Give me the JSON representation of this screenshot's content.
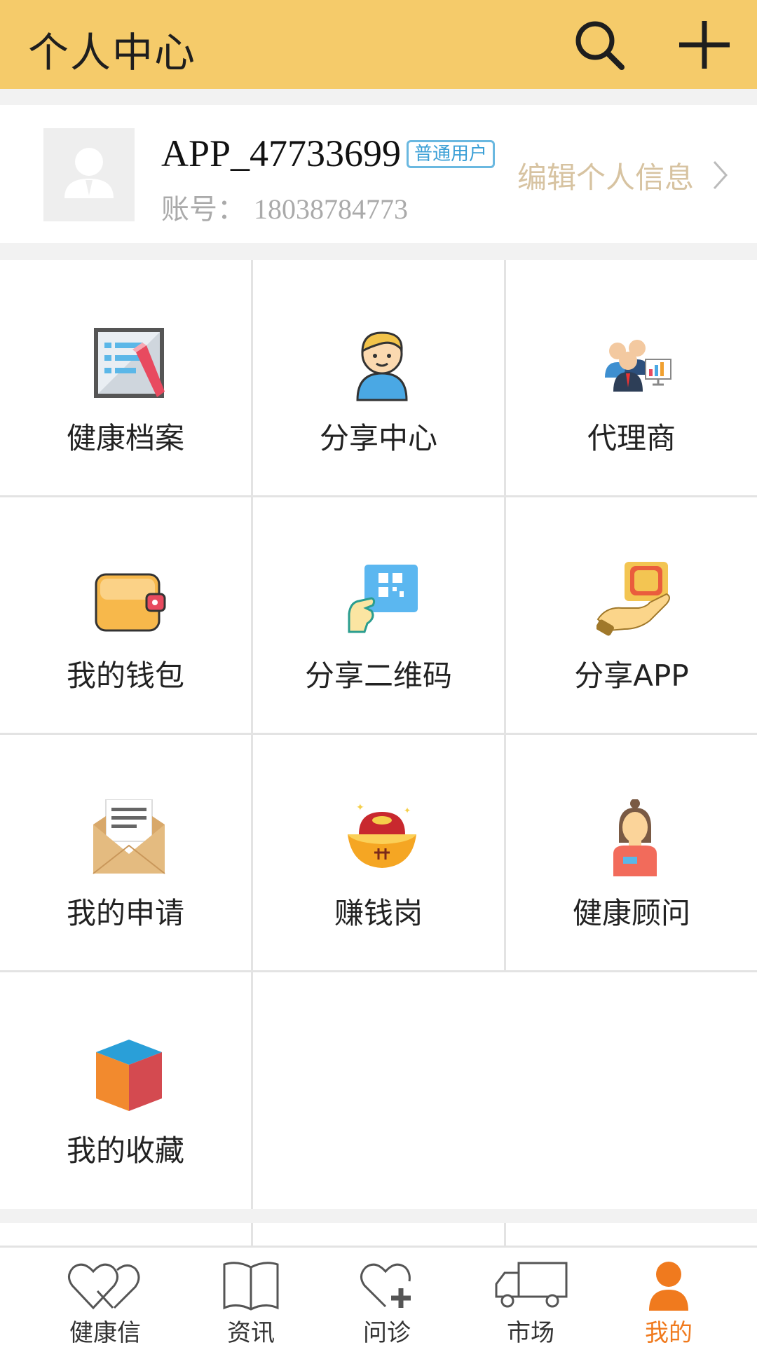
{
  "header": {
    "title": "个人中心",
    "search_icon": "search-icon",
    "add_icon": "plus-icon",
    "bg_color": "#f5cb6a"
  },
  "profile": {
    "username": "APP_47733699",
    "badge": "普通用户",
    "account_label": "账号：",
    "account_number": "18038784773",
    "edit_label": "编辑个人信息"
  },
  "grid": [
    {
      "label": "健康档案",
      "icon": "health-record-icon"
    },
    {
      "label": "分享中心",
      "icon": "share-center-icon"
    },
    {
      "label": "代理商",
      "icon": "agent-icon"
    },
    {
      "label": "我的钱包",
      "icon": "wallet-icon"
    },
    {
      "label": "分享二维码",
      "icon": "qr-code-icon"
    },
    {
      "label": "分享APP",
      "icon": "share-app-icon"
    },
    {
      "label": "我的申请",
      "icon": "application-envelope-icon"
    },
    {
      "label": "赚钱岗",
      "icon": "gold-ingot-icon"
    },
    {
      "label": "健康顾问",
      "icon": "health-advisor-icon"
    },
    {
      "label": "我的收藏",
      "icon": "favorites-cube-icon"
    }
  ],
  "bottom_nav": [
    {
      "label": "健康信",
      "icon": "hearts-icon"
    },
    {
      "label": "资讯",
      "icon": "book-icon"
    },
    {
      "label": "问诊",
      "icon": "heart-plus-icon"
    },
    {
      "label": "市场",
      "icon": "truck-icon"
    },
    {
      "label": "我的",
      "icon": "person-icon",
      "active": true
    }
  ],
  "colors": {
    "accent": "#f07a1e",
    "badge": "#3a9fd6",
    "edit_link": "#d7c3a1"
  }
}
